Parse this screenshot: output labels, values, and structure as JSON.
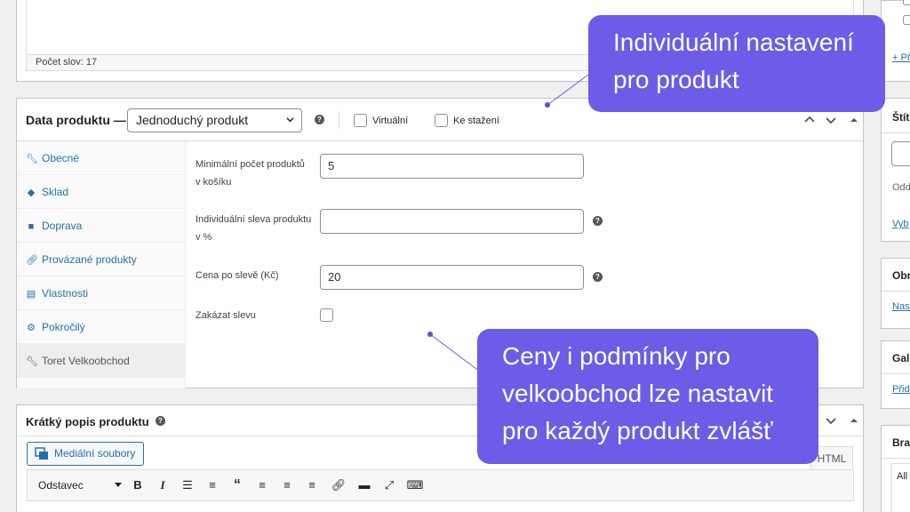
{
  "editor": {
    "word_count": "Počet slov: 17"
  },
  "product_data": {
    "title": "Data produktu —",
    "type_select": "Jednoduchý produkt",
    "virtual_label": "Virtuální",
    "download_label": "Ke stažení",
    "tabs": [
      {
        "label": "Obecné",
        "icon": "wrench-icon"
      },
      {
        "label": "Sklad",
        "icon": "tag-icon"
      },
      {
        "label": "Doprava",
        "icon": "truck-icon"
      },
      {
        "label": "Provázané produkty",
        "icon": "link-icon"
      },
      {
        "label": "Vlastnosti",
        "icon": "list-icon"
      },
      {
        "label": "Pokročilý",
        "icon": "gear-icon"
      },
      {
        "label": "Toret Velkoobchod",
        "icon": "wrench-icon"
      }
    ],
    "fields": {
      "min_qty_label_1": "Minimální počet produktů",
      "min_qty_label_2": "v košíku",
      "min_qty_value": "5",
      "discount_label_1": "Individuální sleva produktu",
      "discount_label_2": "v %",
      "discount_value": "",
      "price_label": "Cena po slevě (Kč)",
      "price_value": "20",
      "disable_label": "Zakázat slevu"
    }
  },
  "short_desc": {
    "title": "Krátký popis produktu",
    "media_button": "Mediální soubory",
    "html_tab": "HTML",
    "format_select": "Odstavec"
  },
  "sidebar": {
    "link_1": "+ Př",
    "title_2": "Štít",
    "text_2": "Odd",
    "link_2": "Vyb",
    "title_3": "Obr",
    "link_3": "Nast",
    "title_4": "Gale",
    "link_4": "Přid",
    "title_5": "Bra",
    "text_5": "All"
  },
  "callouts": {
    "top_line_1": "Individuální nastavení",
    "top_line_2": "pro produkt",
    "bottom_line_1": "Ceny i podmínky pro",
    "bottom_line_2": "velkoobchod lze nastavit",
    "bottom_line_3": "pro každý produkt zvlášť"
  },
  "colors": {
    "accent": "#6c5ce7",
    "link": "#2271b1"
  }
}
